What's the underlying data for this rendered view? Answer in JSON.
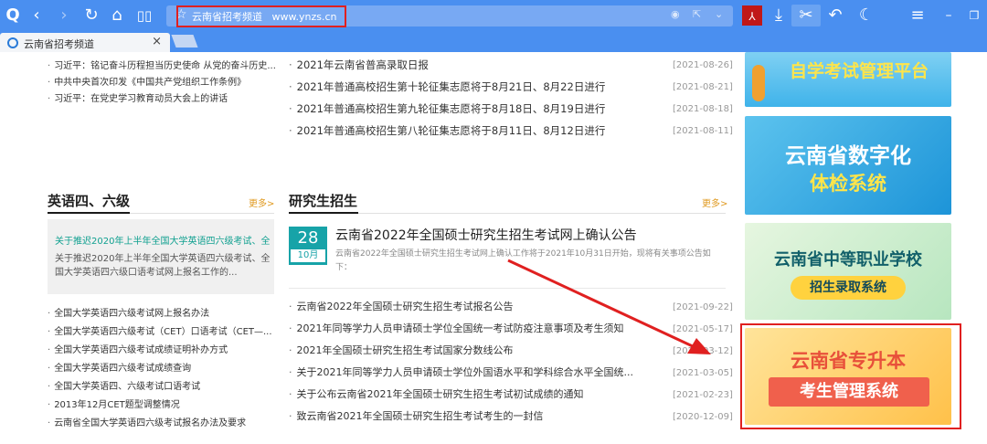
{
  "browser": {
    "address_title": "云南省招考频道",
    "address_url": "www.ynzs.cn",
    "tab_title": "云南省招考频道",
    "tab_close": "×"
  },
  "news_top_left": [
    "习近平：铭记奋斗历程担当历史使命 从党的奋斗历史...",
    "中共中央首次印发《中国共产党组织工作条例》",
    "习近平：在党史学习教育动员大会上的讲话"
  ],
  "news_top_mid": [
    {
      "title": "2021年云南省普高录取日报",
      "date": "[2021-08-26]"
    },
    {
      "title": "2021年普通高校招生第十轮征集志愿将于8月21日、8月22日进行",
      "date": "[2021-08-21]"
    },
    {
      "title": "2021年普通高校招生第九轮征集志愿将于8月18日、8月19日进行",
      "date": "[2021-08-18]"
    },
    {
      "title": "2021年普通高校招生第八轮征集志愿将于8月11日、8月12日进行",
      "date": "[2021-08-11]"
    }
  ],
  "cet": {
    "heading": "英语四、六级",
    "more": "更多>",
    "highlight_title": "关于推迟2020年上半年全国大学英语四六级考试、全",
    "highlight_body": "关于推迟2020年上半年全国大学英语四六级考试、全国大学英语四六级口语考试网上报名工作的...",
    "items": [
      "全国大学英语四六级考试网上报名办法",
      "全国大学英语四六级考试（CET）口语考试（CET—...",
      "全国大学英语四六级考试成绩证明补办方式",
      "全国大学英语四六级考试成绩查询",
      "全国大学英语四、六级考试口语考试",
      "2013年12月CET题型调整情况",
      "云南省全国大学英语四六级考试报名办法及要求"
    ]
  },
  "grad": {
    "heading": "研究生招生",
    "more": "更多>",
    "cal_day": "28",
    "cal_month": "10月",
    "feature_title": "云南省2022年全国硕士研究生招生考试网上确认公告",
    "feature_summary": "云南省2022年全国硕士研究生招生考试网上确认工作将于2021年10月31日开始，现将有关事项公告如下：",
    "items": [
      {
        "title": "云南省2022年全国硕士研究生招生考试报名公告",
        "date": "[2021-09-22]"
      },
      {
        "title": "2021年同等学力人员申请硕士学位全国统一考试防疫注意事项及考生须知",
        "date": "[2021-05-17]"
      },
      {
        "title": "2021年全国硕士研究生招生考试国家分数线公布",
        "date": "[2021-03-12]"
      },
      {
        "title": "关于2021年同等学力人员申请硕士学位外国语水平和学科综合水平全国统...",
        "date": "[2021-03-05]"
      },
      {
        "title": "关于公布云南省2021年全国硕士研究生招生考试初试成绩的通知",
        "date": "[2021-02-23]"
      },
      {
        "title": "致云南省2021年全国硕士研究生招生考试考生的一封信",
        "date": "[2020-12-09]"
      }
    ]
  },
  "banners": {
    "b1": "自学考试管理平台",
    "b2_l1": "云南省数字化",
    "b2_l2": "体检系统",
    "b3_l1": "云南省中等职业学校",
    "b3_l2": "招生录取系统",
    "b4_l1": "云南省专升本",
    "b4_l2": "考生管理系统"
  }
}
